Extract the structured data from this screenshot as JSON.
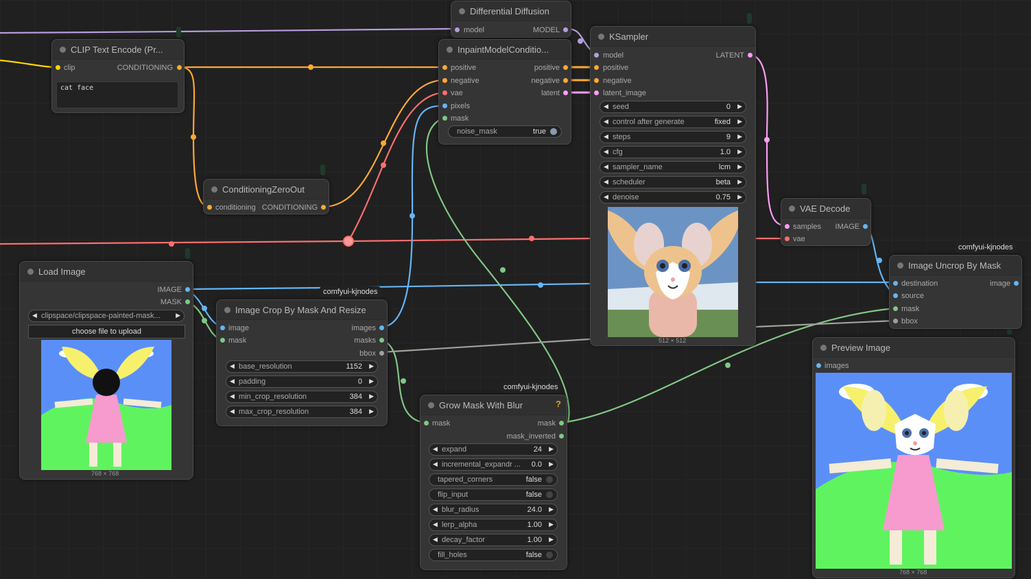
{
  "badges": {
    "kjnodes": "comfyui-kjnodes"
  },
  "colors": {
    "model": "#b39ddb",
    "clip": "#ffd500",
    "conditioning": "#ffa931",
    "vae": "#ff6e6e",
    "image": "#64b5f6",
    "mask": "#81c784",
    "latent": "#ff9cf9",
    "bbox": "#a1a19b"
  },
  "clip_text_encode": {
    "title": "CLIP Text Encode (Pr...",
    "in_clip": "clip",
    "out_conditioning": "CONDITIONING",
    "text": "cat face"
  },
  "differential_diffusion": {
    "title": "Differential Diffusion",
    "in_model": "model",
    "out_model": "MODEL"
  },
  "inpaint_conditioning": {
    "title": "InpaintModelConditio...",
    "in_positive": "positive",
    "in_negative": "negative",
    "in_vae": "vae",
    "in_pixels": "pixels",
    "in_mask": "mask",
    "out_positive": "positive",
    "out_negative": "negative",
    "out_latent": "latent",
    "noise_mask_label": "noise_mask",
    "noise_mask_value": "true"
  },
  "ksampler": {
    "title": "KSampler",
    "in_model": "model",
    "in_positive": "positive",
    "in_negative": "negative",
    "in_latent": "latent_image",
    "out_latent": "LATENT",
    "widgets": [
      {
        "label": "seed",
        "value": "0"
      },
      {
        "label": "control after generate",
        "value": "fixed"
      },
      {
        "label": "steps",
        "value": "9"
      },
      {
        "label": "cfg",
        "value": "1.0"
      },
      {
        "label": "sampler_name",
        "value": "lcm"
      },
      {
        "label": "scheduler",
        "value": "beta"
      },
      {
        "label": "denoise",
        "value": "0.75"
      }
    ],
    "preview_size": "512 × 512"
  },
  "conditioning_zero_out": {
    "title": "ConditioningZeroOut",
    "in_conditioning": "conditioning",
    "out_conditioning": "CONDITIONING"
  },
  "vae_decode": {
    "title": "VAE Decode",
    "in_samples": "samples",
    "in_vae": "vae",
    "out_image": "IMAGE"
  },
  "load_image": {
    "title": "Load Image",
    "out_image": "IMAGE",
    "out_mask": "MASK",
    "file": "clipspace/clipspace-painted-mask...",
    "upload": "choose file to upload",
    "preview_size": "768 × 768"
  },
  "crop_by_mask": {
    "title": "Image Crop By Mask And Resize",
    "in_image": "image",
    "in_mask": "mask",
    "out_images": "images",
    "out_masks": "masks",
    "out_bbox": "bbox",
    "widgets": [
      {
        "label": "base_resolution",
        "value": "1152"
      },
      {
        "label": "padding",
        "value": "0"
      },
      {
        "label": "min_crop_resolution",
        "value": "384"
      },
      {
        "label": "max_crop_resolution",
        "value": "384"
      }
    ]
  },
  "grow_mask": {
    "title": "Grow Mask With Blur",
    "help": "?",
    "in_mask": "mask",
    "out_mask": "mask",
    "out_mask_inverted": "mask_inverted",
    "widgets": [
      {
        "label": "expand",
        "value": "24",
        "kind": "num"
      },
      {
        "label": "incremental_expandr ...",
        "value": "0.0",
        "kind": "num"
      },
      {
        "label": "tapered_corners",
        "value": "false",
        "kind": "bool"
      },
      {
        "label": "flip_input",
        "value": "false",
        "kind": "bool"
      },
      {
        "label": "blur_radius",
        "value": "24.0",
        "kind": "num"
      },
      {
        "label": "lerp_alpha",
        "value": "1.00",
        "kind": "num"
      },
      {
        "label": "decay_factor",
        "value": "1.00",
        "kind": "num"
      },
      {
        "label": "fill_holes",
        "value": "false",
        "kind": "bool"
      }
    ]
  },
  "uncrop": {
    "title": "Image Uncrop By Mask",
    "in_destination": "destination",
    "in_source": "source",
    "in_mask": "mask",
    "in_bbox": "bbox",
    "out_image": "image"
  },
  "preview_image": {
    "title": "Preview Image",
    "in_images": "images",
    "preview_size": "768 × 768"
  }
}
